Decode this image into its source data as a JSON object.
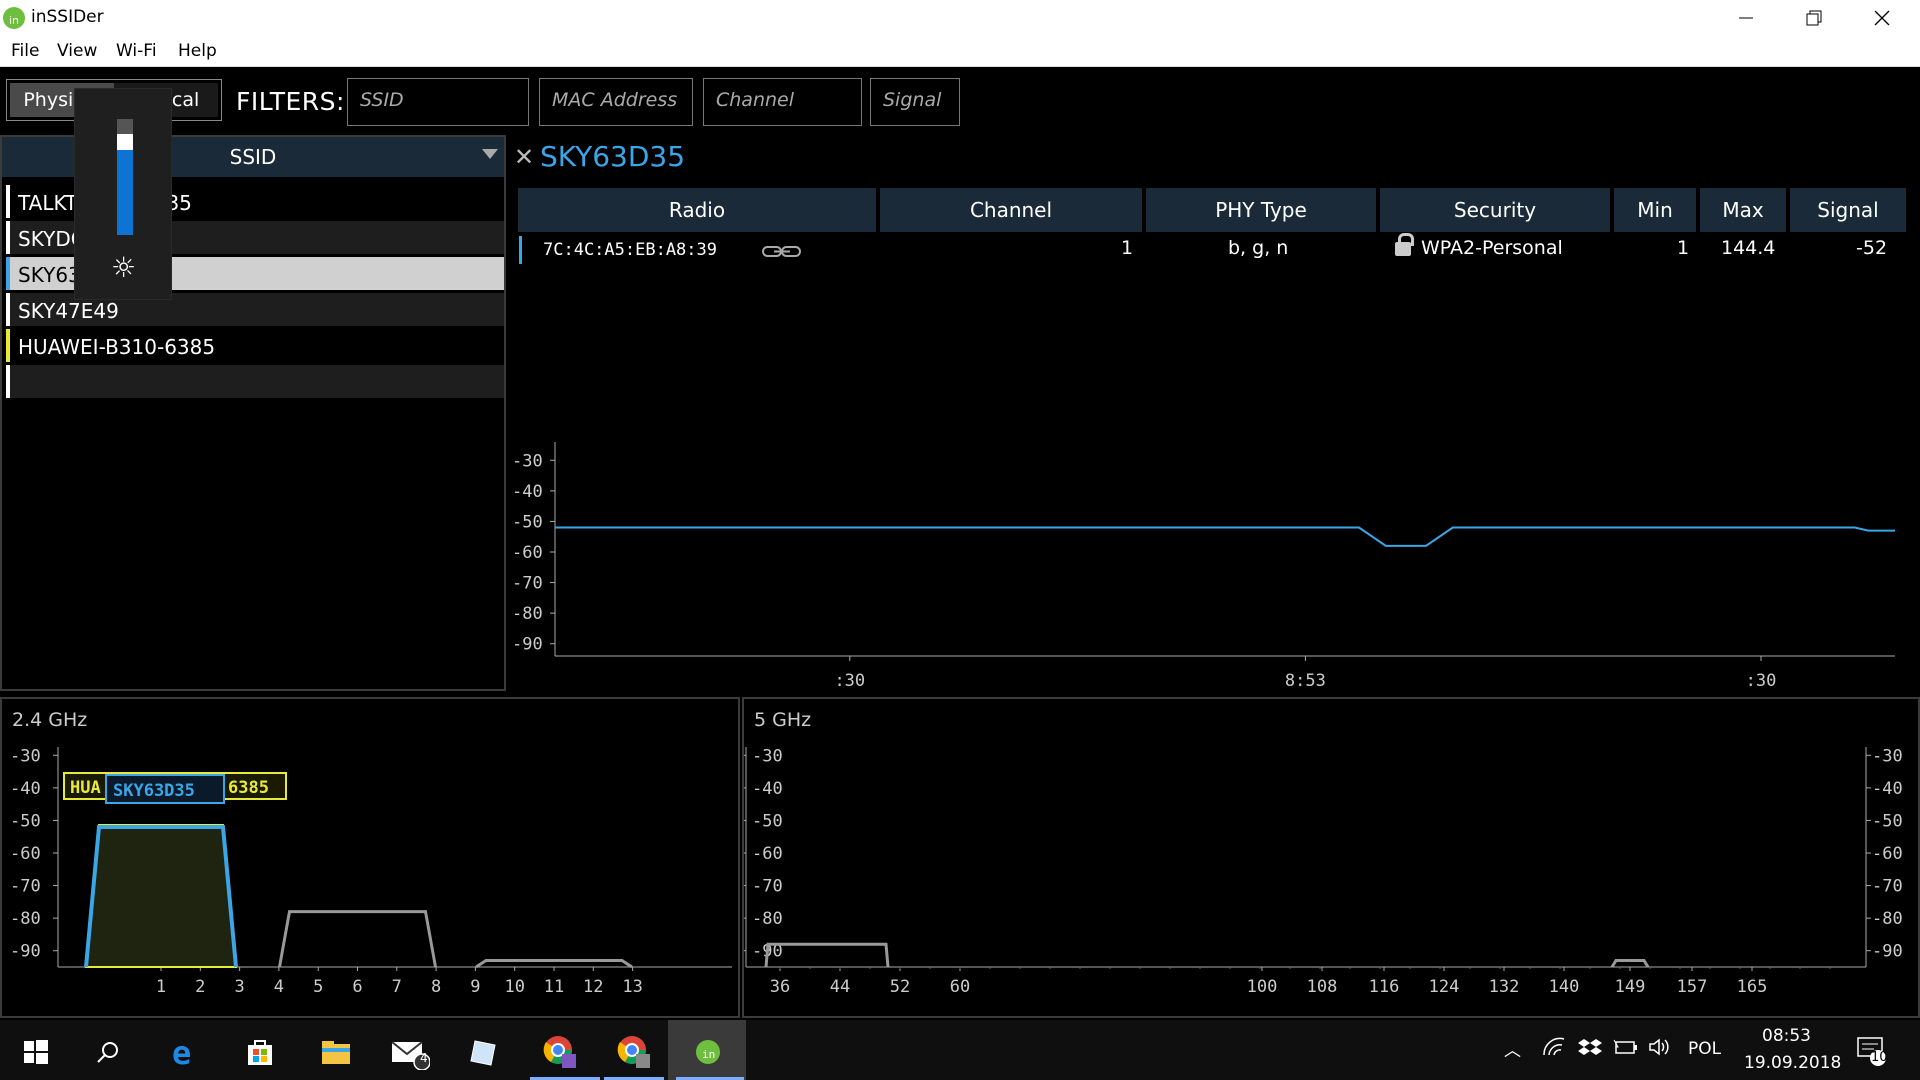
{
  "app": {
    "title": "inSSIDer",
    "logo_text": "in"
  },
  "menu": [
    "File",
    "View",
    "Wi-Fi",
    "Help"
  ],
  "toolbar": {
    "physical": "Physical",
    "logical": "Logical",
    "filters_label": "FILTERS:",
    "ssid_placeholder": "SSID",
    "mac_placeholder": "MAC Address",
    "channel_placeholder": "Channel",
    "signal_placeholder": "Signal"
  },
  "ssid_list": {
    "header": "SSID",
    "rows": [
      {
        "label": "TALKTALK5BC835",
        "color": "#ffffff",
        "selected": false
      },
      {
        "label": "SKYDC8A9",
        "color": "#ffffff",
        "selected": false
      },
      {
        "label": "SKY63D35",
        "color": "#3aa6e8",
        "selected": true
      },
      {
        "label": "SKY47E49",
        "color": "#ffffff",
        "selected": false
      },
      {
        "label": "HUAWEI-B310-6385",
        "color": "#e8ea3a",
        "selected": false
      },
      {
        "label": "",
        "color": "#ffffff",
        "selected": false
      }
    ]
  },
  "brightness": {
    "level": 0.85
  },
  "detail": {
    "title": "SKY63D35",
    "columns": [
      "Radio",
      "Channel",
      "PHY Type",
      "Security",
      "Min",
      "Max",
      "Signal"
    ],
    "row": {
      "radio": "7C:4C:A5:EB:A8:39",
      "channel": "1",
      "phy": "b, g, n",
      "security": "WPA2-Personal",
      "min": "1",
      "max": "144.4",
      "signal": "-52"
    }
  },
  "signal_chart": {
    "y_ticks": [
      "-30",
      "-40",
      "-50",
      "-60",
      "-70",
      "-80",
      "-90"
    ],
    "x_ticks": [
      ":30",
      "8:53",
      ":30"
    ],
    "color": "#3aa6e8"
  },
  "band24": {
    "title": "2.4 GHz",
    "y_ticks": [
      "-30",
      "-40",
      "-50",
      "-60",
      "-70",
      "-80",
      "-90"
    ],
    "x_ticks": [
      "1",
      "2",
      "3",
      "4",
      "5",
      "6",
      "7",
      "8",
      "9",
      "10",
      "11",
      "12",
      "13"
    ],
    "label_huawei_left": "HUA",
    "label_huawei_right": "6385",
    "label_sky": "SKY63D35"
  },
  "band5": {
    "title": "5 GHz",
    "y_ticks": [
      "-30",
      "-40",
      "-50",
      "-60",
      "-70",
      "-80",
      "-90"
    ],
    "x_ticks": [
      "36",
      "44",
      "52",
      "60",
      "100",
      "108",
      "116",
      "124",
      "132",
      "140",
      "149",
      "157",
      "165"
    ]
  },
  "chart_data": [
    {
      "type": "line",
      "title": "",
      "xlabel": "",
      "ylabel": "",
      "x_ticks": [
        ":30",
        "8:53",
        ":30"
      ],
      "ylim": [
        -95,
        -25
      ],
      "series": [
        {
          "name": "SKY63D35",
          "color": "#3aa6e8",
          "x": [
            0,
            0.6,
            0.62,
            0.65,
            0.67,
            0.97,
            0.98,
            1.0
          ],
          "values": [
            -52,
            -52,
            -58,
            -58,
            -52,
            -52,
            -53,
            -53
          ]
        }
      ]
    },
    {
      "type": "area",
      "title": "2.4 GHz",
      "xlabel": "",
      "ylabel": "",
      "ylim": [
        -95,
        -25
      ],
      "series": [
        {
          "name": "SKY63D35",
          "center": 1,
          "signal": -52,
          "color": "#3aa6e8"
        },
        {
          "name": "HUAWEI-B310-6385",
          "center": 1,
          "signal": -52,
          "color": "#e8ea3a"
        },
        {
          "name": "",
          "center": 6,
          "signal": -78,
          "color": "#999999"
        },
        {
          "name": "",
          "center": 11,
          "signal": -93,
          "color": "#999999"
        }
      ]
    },
    {
      "type": "area",
      "title": "5 GHz",
      "xlabel": "",
      "ylabel": "",
      "ylim": [
        -95,
        -25
      ],
      "series": [
        {
          "name": "",
          "center": 44,
          "signal": -88,
          "color": "#999999"
        },
        {
          "name": "",
          "center": 149,
          "signal": -93,
          "color": "#999999"
        }
      ]
    }
  ],
  "taskbar": {
    "mail_badge": "4",
    "language": "POL",
    "time": "08:53",
    "date": "19.09.2018",
    "notif_count": "10"
  }
}
